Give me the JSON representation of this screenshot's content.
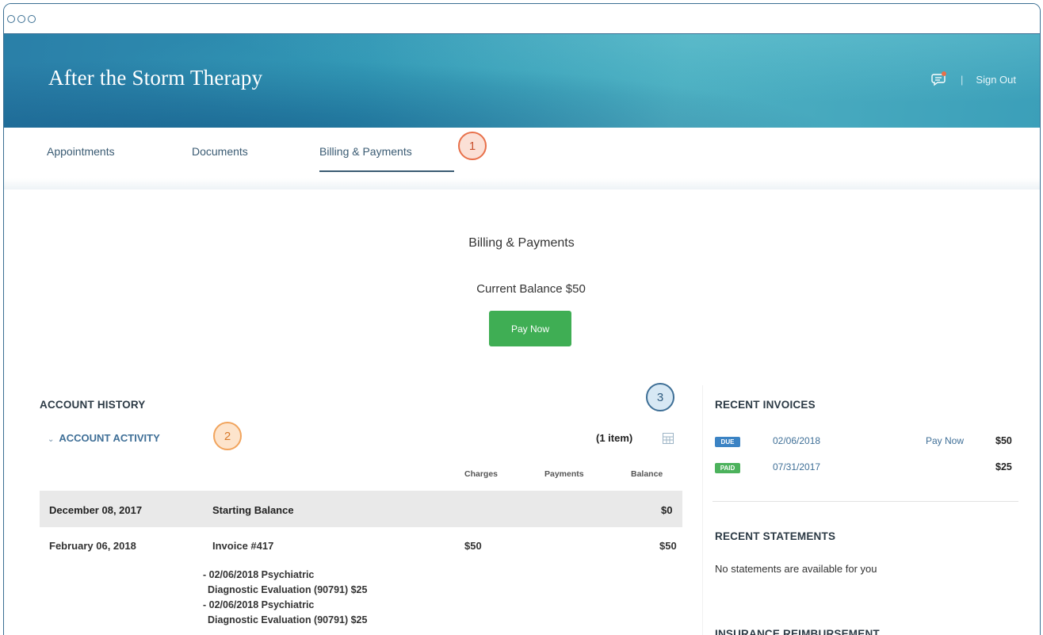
{
  "header": {
    "brand": "After the Storm Therapy",
    "sign_out": "Sign Out"
  },
  "tabs": [
    {
      "label": "Appointments"
    },
    {
      "label": "Documents"
    },
    {
      "label": "Billing & Payments",
      "active": true
    }
  ],
  "callouts": [
    "1",
    "2",
    "3"
  ],
  "summary": {
    "title": "Billing & Payments",
    "balance": "Current Balance $50",
    "pay_button": "Pay Now"
  },
  "account_history": {
    "heading": "ACCOUNT HISTORY",
    "activity_label": "ACCOUNT ACTIVITY",
    "item_count": "(1 item)",
    "columns": [
      "Charges",
      "Payments",
      "Balance"
    ],
    "rows": [
      {
        "date": "December 08, 2017",
        "description": "Starting Balance",
        "charges": "",
        "payments": "",
        "balance": "$0"
      },
      {
        "date": "February 06, 2018",
        "description": "Invoice #417",
        "charges": "$50",
        "payments": "",
        "balance": "$50",
        "details": [
          "- 02/06/2018 Psychiatric",
          "Diagnostic Evaluation (90791) $25",
          "- 02/06/2018 Psychiatric",
          "Diagnostic Evaluation (90791) $25"
        ]
      }
    ]
  },
  "recent_invoices": {
    "heading": "RECENT INVOICES",
    "items": [
      {
        "status": "DUE",
        "date": "02/06/2018",
        "action": "Pay Now",
        "amount": "$50"
      },
      {
        "status": "PAID",
        "date": "07/31/2017",
        "action": "",
        "amount": "$25"
      }
    ]
  },
  "recent_statements": {
    "heading": "RECENT STATEMENTS",
    "empty_text": "No statements are available for you"
  },
  "insurance": {
    "heading": "INSURANCE REIMBURSEMENT"
  },
  "colors": {
    "accent_blue": "#3f6f97",
    "pay_green": "#3fae54",
    "badge_due": "#3b83c4",
    "badge_paid": "#4cb25c",
    "callout_1": "#e8704a",
    "callout_2": "#f1a45d",
    "callout_3": "#3e6f96"
  },
  "icons": [
    "messages-icon",
    "chevron-down-icon",
    "grid-view-icon"
  ]
}
